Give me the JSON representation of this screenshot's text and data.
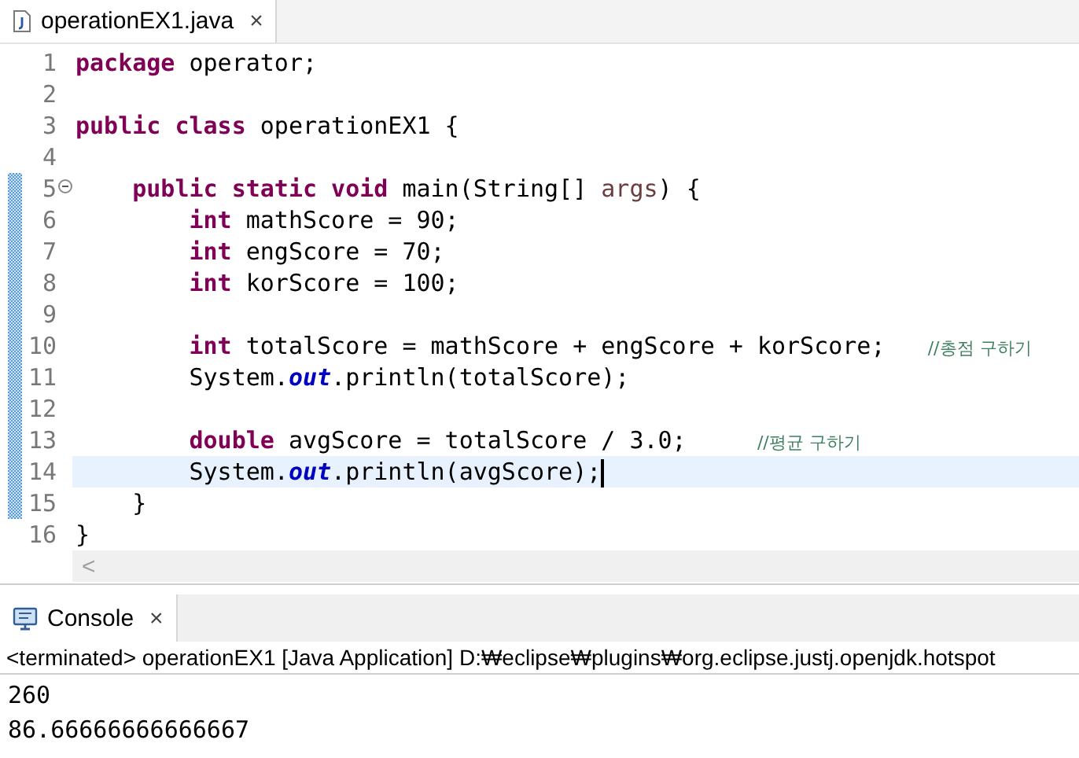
{
  "editor": {
    "tab": {
      "title": "operationEX1.java",
      "close": "×",
      "selected": true
    },
    "lines": [
      {
        "number": "1",
        "changed": false,
        "current": false,
        "tokens": [
          {
            "kind": "keyword",
            "text": "package"
          },
          {
            "kind": "plain",
            "text": " operator;"
          }
        ]
      },
      {
        "number": "2",
        "changed": false,
        "current": false
      },
      {
        "number": "3",
        "changed": false,
        "current": false,
        "tokens": [
          {
            "kind": "keyword",
            "text": "public "
          },
          {
            "kind": "keyword",
            "text": "class"
          },
          {
            "kind": "plain",
            "text": " operationEX1 {"
          }
        ],
        "children": [
          {
            "number": "4",
            "changed": false,
            "current": false
          },
          {
            "number": "5",
            "changed": true,
            "current": false,
            "expanded": true,
            "tokens": [
              {
                "kind": "keyword",
                "text": "public "
              },
              {
                "kind": "keyword",
                "text": "static "
              },
              {
                "kind": "keyword",
                "text": "void"
              },
              {
                "kind": "plain",
                "text": " main(String[] "
              },
              {
                "kind": "param",
                "text": "args"
              },
              {
                "kind": "plain",
                "text": ") {"
              }
            ],
            "children": [
              {
                "number": "6",
                "changed": true,
                "current": false,
                "tokens": [
                  {
                    "kind": "keyword",
                    "text": "int"
                  },
                  {
                    "kind": "plain",
                    "text": " mathScore = 90;"
                  }
                ]
              },
              {
                "number": "7",
                "changed": true,
                "current": false,
                "tokens": [
                  {
                    "kind": "keyword",
                    "text": "int"
                  },
                  {
                    "kind": "plain",
                    "text": " engScore = 70;"
                  }
                ]
              },
              {
                "number": "8",
                "changed": true,
                "current": false,
                "tokens": [
                  {
                    "kind": "keyword",
                    "text": "int"
                  },
                  {
                    "kind": "plain",
                    "text": " korScore = 100;"
                  }
                ]
              },
              {
                "number": "9",
                "changed": true,
                "current": false
              },
              {
                "number": "10",
                "changed": true,
                "current": false,
                "tokens": [
                  {
                    "kind": "keyword",
                    "text": "int"
                  },
                  {
                    "kind": "plain",
                    "text": " totalScore = mathScore + engScore + korScore;   "
                  },
                  {
                    "kind": "comment",
                    "text": "//총점 구하기"
                  }
                ]
              },
              {
                "number": "11",
                "changed": true,
                "current": false,
                "tokens": [
                  {
                    "kind": "plain",
                    "text": "System."
                  },
                  {
                    "kind": "field",
                    "text": "out"
                  },
                  {
                    "kind": "plain",
                    "text": ".println(totalScore);"
                  }
                ]
              },
              {
                "number": "12",
                "changed": true,
                "current": false
              },
              {
                "number": "13",
                "changed": true,
                "current": false,
                "tokens": [
                  {
                    "kind": "keyword",
                    "text": "double"
                  },
                  {
                    "kind": "plain",
                    "text": " avgScore = totalScore / 3.0;     "
                  },
                  {
                    "kind": "comment",
                    "text": "//평균 구하기"
                  }
                ]
              },
              {
                "number": "14",
                "changed": true,
                "current": true,
                "tokens": [
                  {
                    "kind": "plain",
                    "text": "System."
                  },
                  {
                    "kind": "field",
                    "text": "out"
                  },
                  {
                    "kind": "plain",
                    "text": ".println(avgScore);"
                  }
                ]
              }
            ]
          },
          {
            "number": "15",
            "changed": true,
            "current": false,
            "tokens": [
              {
                "kind": "plain",
                "text": "}"
              }
            ]
          }
        ]
      },
      {
        "number": "16",
        "changed": false,
        "current": false,
        "tokens": [
          {
            "kind": "plain",
            "text": "}"
          }
        ]
      }
    ],
    "scroll_left": "<"
  },
  "console": {
    "tab": {
      "title": "Console",
      "close": "×",
      "selected": true
    },
    "status": "<terminated> operationEX1 [Java Application] D:₩eclipse₩plugins₩org.eclipse.justj.openjdk.hotspot",
    "output": [
      "260",
      "86.66666666666667"
    ]
  }
}
